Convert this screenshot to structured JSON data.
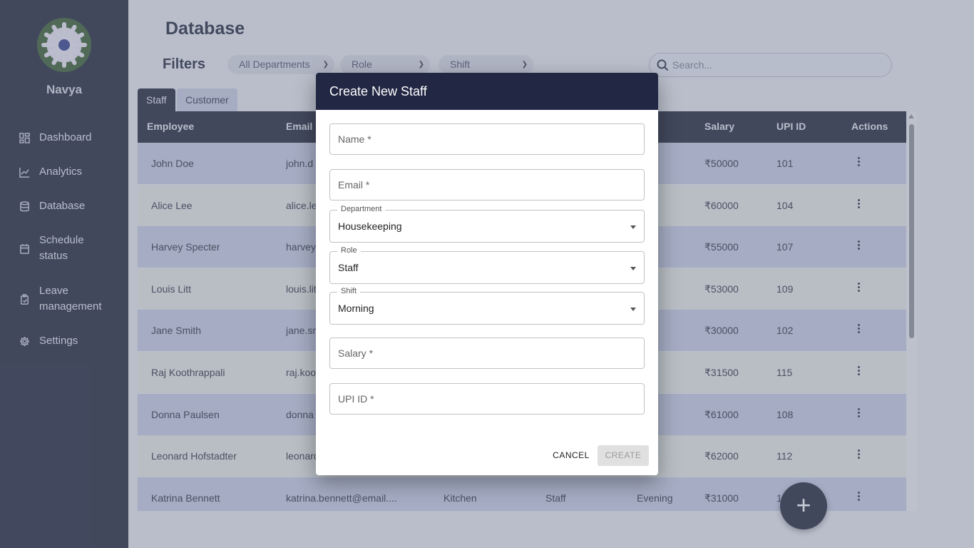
{
  "sidebar": {
    "user_name": "Navya",
    "items": [
      {
        "label": "Dashboard",
        "icon": "dashboard-icon"
      },
      {
        "label": "Analytics",
        "icon": "analytics-icon"
      },
      {
        "label": "Database",
        "icon": "database-icon"
      },
      {
        "label": "Schedule status",
        "icon": "calendar-icon"
      },
      {
        "label": "Leave management",
        "icon": "clipboard-icon"
      },
      {
        "label": "Settings",
        "icon": "gear-icon"
      }
    ]
  },
  "header": {
    "title": "Database",
    "filters_label": "Filters",
    "department_filter": "All Departments",
    "role_filter": "Role",
    "shift_filter": "Shift",
    "search_placeholder": "Search..."
  },
  "tabs": [
    {
      "label": "Staff",
      "active": true
    },
    {
      "label": "Customer",
      "active": false
    }
  ],
  "table": {
    "columns": [
      "Employee",
      "Email",
      "Salary",
      "UPI ID",
      "Actions"
    ],
    "rows": [
      {
        "employee": "John Doe",
        "email": "john.d",
        "department": "",
        "role": "",
        "shift": "",
        "salary": "₹50000",
        "upi": "101"
      },
      {
        "employee": "Alice Lee",
        "email": "alice.le",
        "department": "",
        "role": "",
        "shift": "",
        "salary": "₹60000",
        "upi": "104"
      },
      {
        "employee": "Harvey Specter",
        "email": "harvey",
        "department": "",
        "role": "",
        "shift": "t",
        "salary": "₹55000",
        "upi": "107"
      },
      {
        "employee": "Louis Litt",
        "email": "louis.lit",
        "department": "",
        "role": "",
        "shift": "ing",
        "salary": "₹53000",
        "upi": "109"
      },
      {
        "employee": "Jane Smith",
        "email": "jane.sn",
        "department": "",
        "role": "",
        "shift": "t",
        "salary": "₹30000",
        "upi": "102"
      },
      {
        "employee": "Raj Koothrappali",
        "email": "raj.koo",
        "department": "",
        "role": "",
        "shift": "t",
        "salary": "₹31500",
        "upi": "115"
      },
      {
        "employee": "Donna Paulsen",
        "email": "donna",
        "department": "",
        "role": "",
        "shift": "ing",
        "salary": "₹61000",
        "upi": "108"
      },
      {
        "employee": "Leonard Hofstadter",
        "email": "leonard",
        "department": "",
        "role": "",
        "shift": "ning",
        "salary": "₹62000",
        "upi": "112"
      },
      {
        "employee": "Katrina Bennett",
        "email": "katrina.bennett@email....",
        "department": "Kitchen",
        "role": "Staff",
        "shift": "Evening",
        "salary": "₹31000",
        "upi": "110"
      }
    ]
  },
  "dialog": {
    "title": "Create New Staff",
    "name_placeholder": "Name *",
    "email_placeholder": "Email *",
    "department_label": "Department",
    "department_value": "Housekeeping",
    "role_label": "Role",
    "role_value": "Staff",
    "shift_label": "Shift",
    "shift_value": "Morning",
    "salary_placeholder": "Salary *",
    "upi_placeholder": "UPI ID *",
    "cancel_label": "CANCEL",
    "create_label": "CREATE"
  },
  "fab": {
    "label": "+"
  }
}
